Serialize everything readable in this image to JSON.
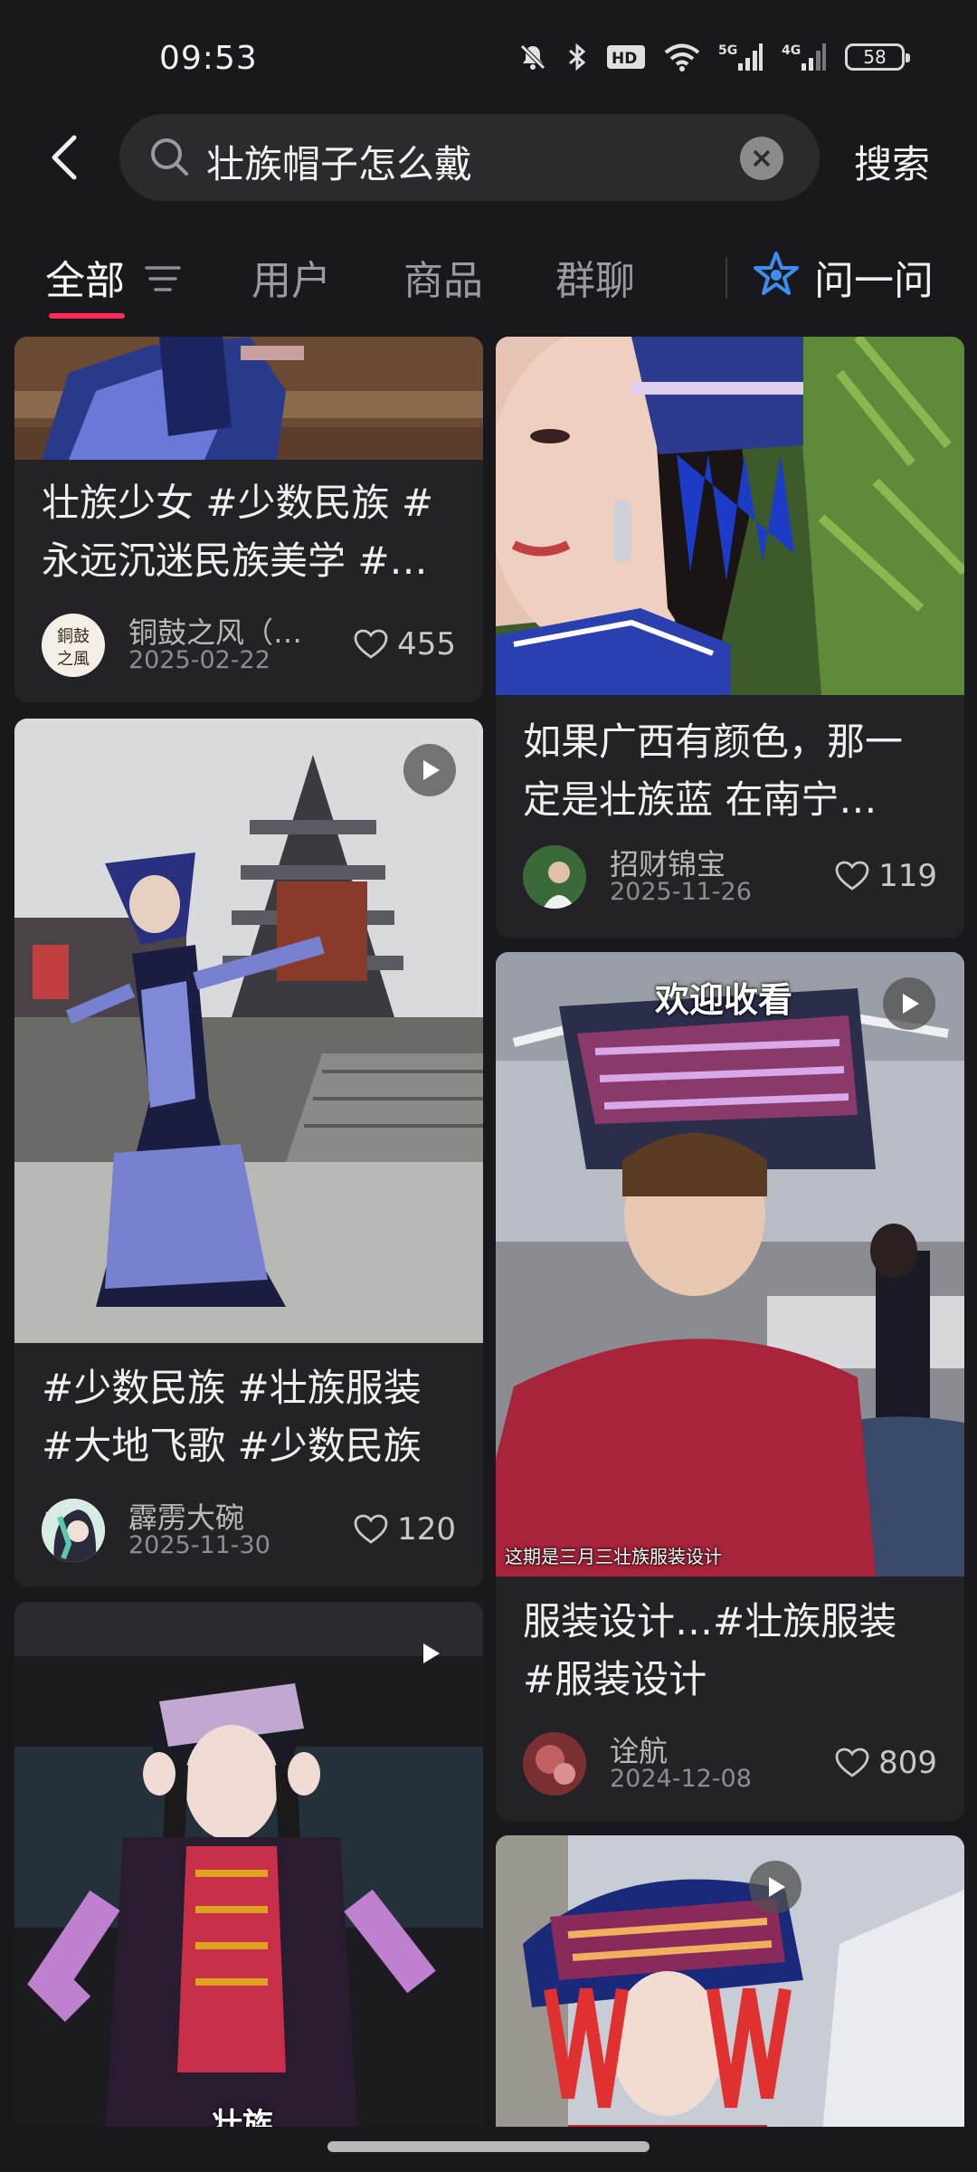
{
  "status_bar": {
    "time": "09:53",
    "network_1": "5G",
    "network_2": "4G",
    "hd": "HD",
    "battery": "58"
  },
  "search": {
    "query": "壮族帽子怎么戴",
    "submit_label": "搜索"
  },
  "tabs": [
    {
      "label": "全部",
      "active": true
    },
    {
      "label": "用户"
    },
    {
      "label": "商品"
    },
    {
      "label": "群聊"
    }
  ],
  "ask_label": "问一问",
  "colors": {
    "accent": "#ff2b54",
    "ask_icon": "#3b8ef0",
    "background": "#19191d",
    "card": "#232327"
  },
  "cards": [
    {
      "title": "壮族少女 #少数民族 #永远沉迷民族美学 #…",
      "author": "铜鼓之风（…",
      "date": "2025-02-22",
      "likes": "455",
      "avatar_text": "銅鼓之風"
    },
    {
      "title": "如果广西有颜色，那一定是壮族蓝 在南宁…",
      "author": "招财锦宝",
      "date": "2025-11-26",
      "likes": "119"
    },
    {
      "title": "#少数民族 #壮族服装 #大地飞歌 #少数民族 …",
      "author": "霹雳大碗",
      "date": "2025-11-30",
      "likes": "120",
      "video": true
    },
    {
      "title": "服装设计…#壮族服装 #服装设计",
      "author": "诠航",
      "date": "2024-12-08",
      "likes": "809",
      "video": true,
      "overlay_top": "欢迎收看",
      "overlay_bottom": "这期是三月三壮族服装设计"
    },
    {
      "video": true,
      "overlay_bottom": "壮族"
    },
    {
      "video": true
    }
  ]
}
